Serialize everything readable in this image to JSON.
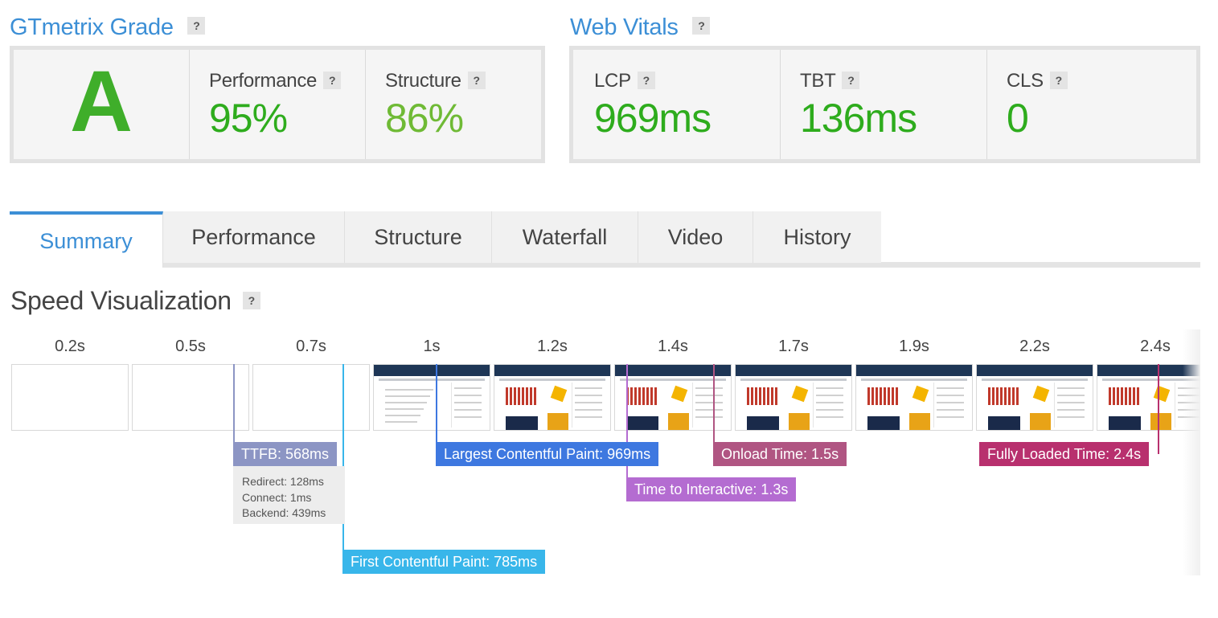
{
  "grade": {
    "title": "GTmetrix Grade",
    "help": "?",
    "letter": "A",
    "performance": {
      "label": "Performance",
      "value": "95%"
    },
    "structure": {
      "label": "Structure",
      "value": "86%"
    }
  },
  "vitals": {
    "title": "Web Vitals",
    "help": "?",
    "lcp": {
      "label": "LCP",
      "value": "969ms"
    },
    "tbt": {
      "label": "TBT",
      "value": "136ms"
    },
    "cls": {
      "label": "CLS",
      "value": "0"
    }
  },
  "tabs": [
    "Summary",
    "Performance",
    "Structure",
    "Waterfall",
    "Video",
    "History"
  ],
  "active_tab": "Summary",
  "speed": {
    "title": "Speed Visualization",
    "help": "?",
    "frames": [
      "0.2s",
      "0.5s",
      "0.7s",
      "1s",
      "1.2s",
      "1.4s",
      "1.7s",
      "1.9s",
      "2.2s",
      "2.4s"
    ],
    "loaded_from_frame_index": 3,
    "markers": {
      "ttfb": "TTFB: 568ms",
      "lcp": "Largest Contentful Paint: 969ms",
      "onload": "Onload Time: 1.5s",
      "fully_loaded": "Fully Loaded Time: 2.4s",
      "tti": "Time to Interactive: 1.3s",
      "fcp": "First Contentful Paint: 785ms"
    },
    "ttfb_details": {
      "redirect": "Redirect: 128ms",
      "connect": "Connect: 1ms",
      "backend": "Backend: 439ms"
    }
  },
  "colors": {
    "accent": "#3c8fd6",
    "good": "#2eac1d",
    "ttfb": "#8c95c4",
    "fcp": "#38b6ea",
    "lcp": "#3e78e0",
    "tti": "#b46cd1",
    "onload": "#b05582",
    "fully_loaded": "#b8306e"
  }
}
